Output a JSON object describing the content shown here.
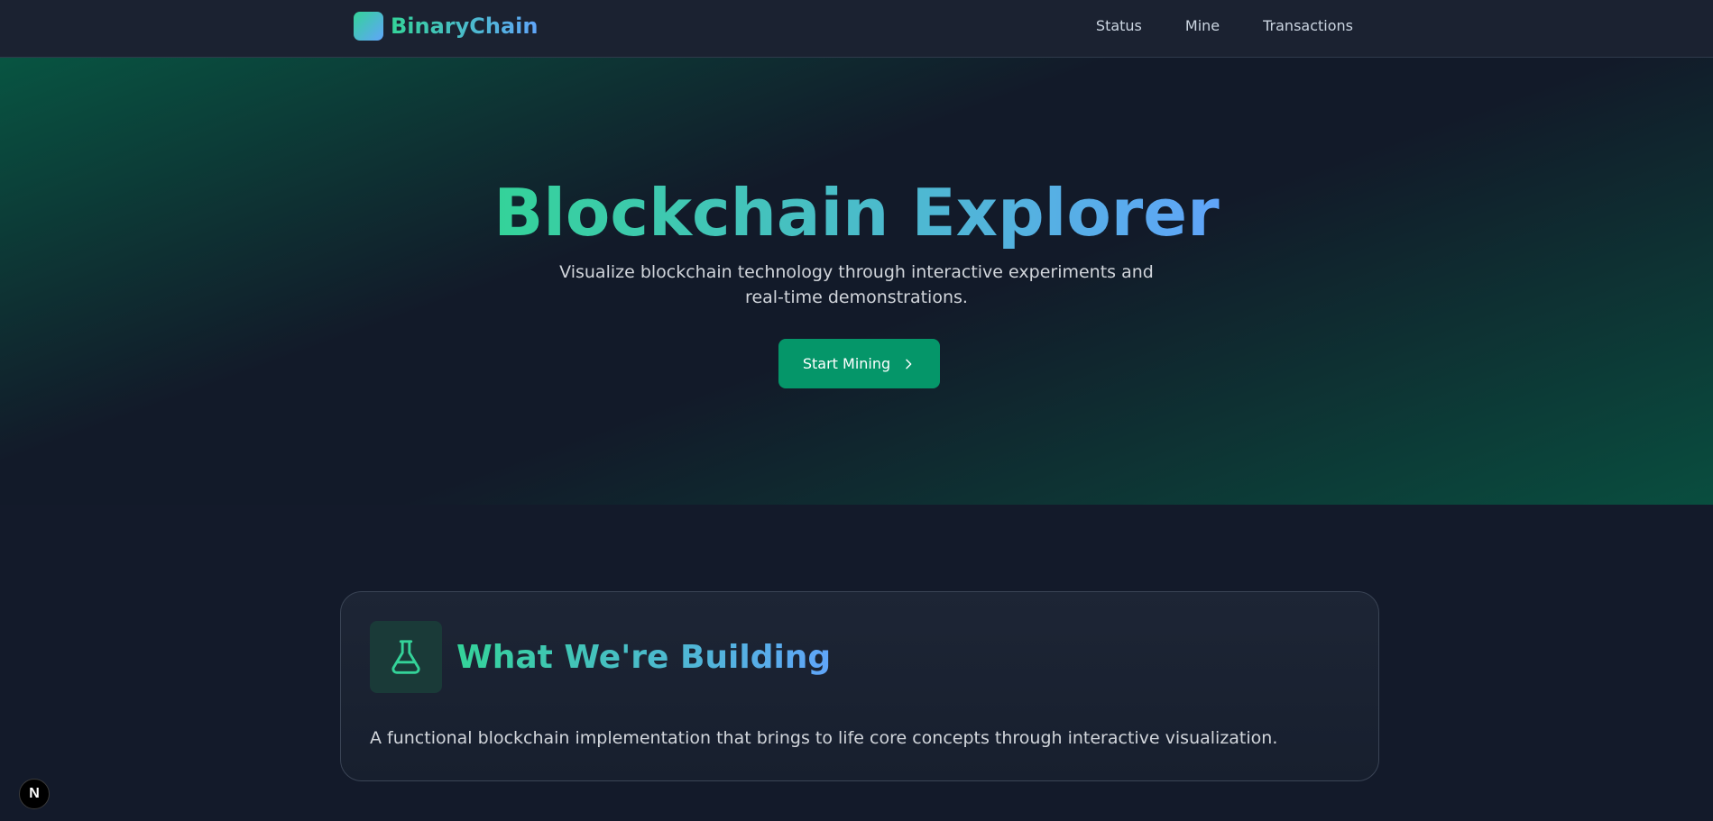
{
  "nav": {
    "brand": "BinaryChain",
    "links": [
      "Status",
      "Mine",
      "Transactions"
    ]
  },
  "hero": {
    "title": "Blockchain Explorer",
    "subtitle": "Visualize blockchain technology through interactive experiments and real-time demonstrations.",
    "cta_label": "Start Mining",
    "cta_icon": "chevron-right-icon"
  },
  "card": {
    "icon": "flask-icon",
    "title": "What We're Building",
    "text": "A functional blockchain implementation that brings to life core concepts through interactive visualization."
  },
  "badge": {
    "label": "N"
  },
  "colors": {
    "background": "#131a2a",
    "accent_green": "#34d399",
    "accent_blue": "#60a5fa",
    "button": "#059669"
  }
}
